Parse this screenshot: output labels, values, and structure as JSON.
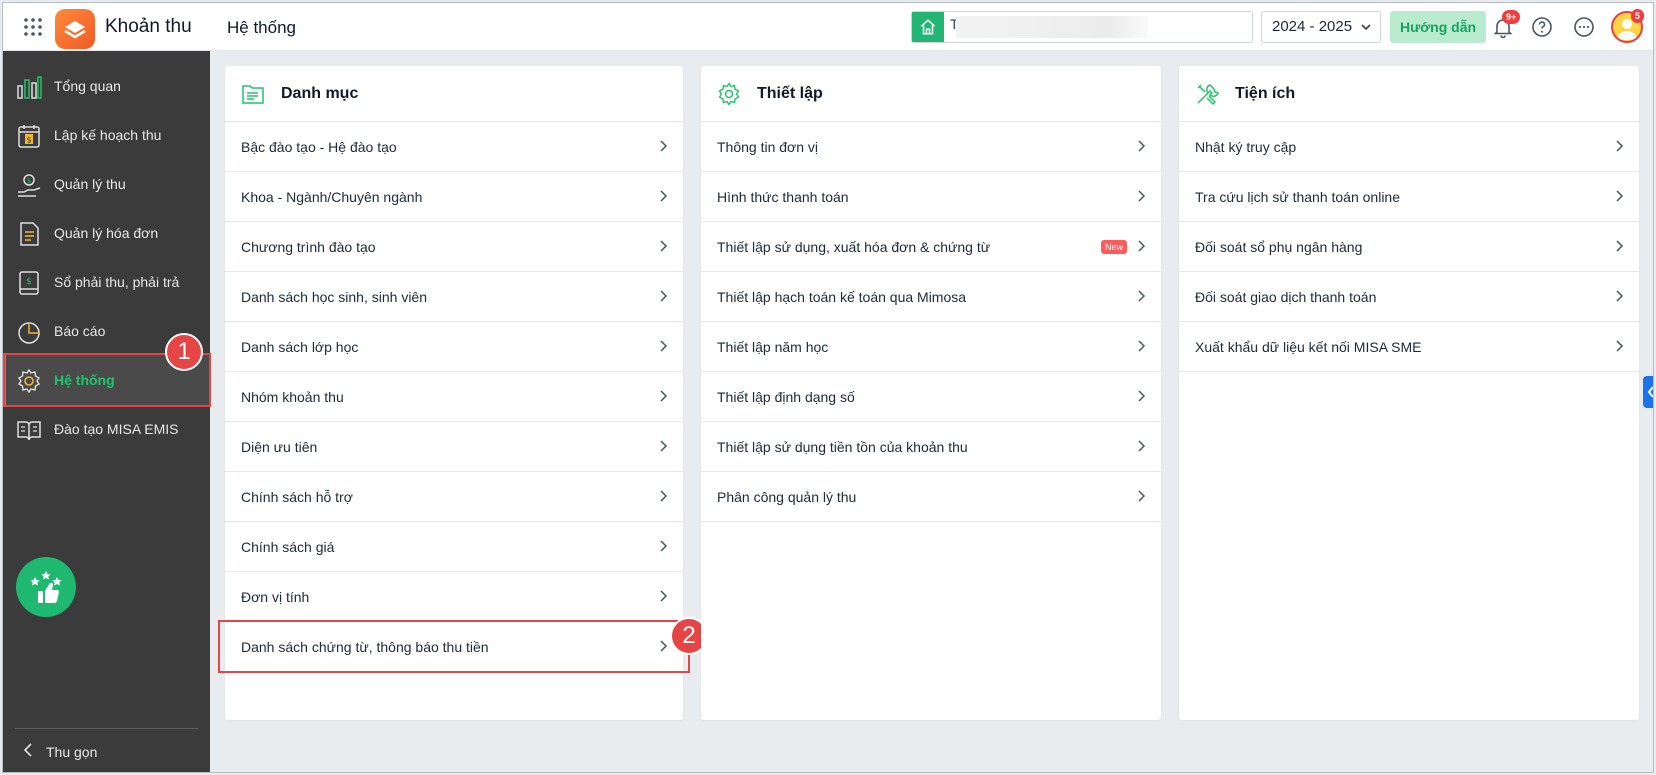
{
  "header": {
    "app_title": "Khoản thu",
    "page_title": "Hệ thống",
    "search_value": "T",
    "school_year": "2024 - 2025",
    "guide_label": "Hướng dẫn",
    "notification_badge": "9+",
    "avatar_badge": "5"
  },
  "sidebar": {
    "items": [
      {
        "label": "Tổng quan",
        "icon": "bar-chart-icon"
      },
      {
        "label": "Lập kế hoạch thu",
        "icon": "calendar-dollar-icon"
      },
      {
        "label": "Quản lý thu",
        "icon": "hand-coin-icon"
      },
      {
        "label": "Quản lý hóa đơn",
        "icon": "invoice-icon"
      },
      {
        "label": "Sổ phải thu, phải trả",
        "icon": "ledger-icon"
      },
      {
        "label": "Báo cáo",
        "icon": "pie-chart-icon"
      },
      {
        "label": "Hệ thống",
        "icon": "gear-icon",
        "active": true
      },
      {
        "label": "Đào tạo MISA EMIS",
        "icon": "book-icon"
      }
    ],
    "collapse_label": "Thu gọn"
  },
  "annotations": {
    "step1": "1",
    "step2": "2"
  },
  "panels": [
    {
      "title": "Danh mục",
      "icon": "folder-list-icon",
      "items": [
        "Bậc đào tạo - Hệ đào tạo",
        "Khoa - Ngành/Chuyên ngành",
        "Chương trình đào tạo",
        "Danh sách học sinh, sinh viên",
        "Danh sách lớp học",
        "Nhóm khoản thu",
        "Diện ưu tiên",
        "Chính sách hỗ trợ",
        "Chính sách giá",
        "Đơn vị tính",
        "Danh sách chứng từ, thông báo thu tiền"
      ]
    },
    {
      "title": "Thiết lập",
      "icon": "settings-icon",
      "items": [
        "Thông tin đơn vị",
        "Hình thức thanh toán",
        "Thiết lập sử dụng, xuất hóa đơn & chứng từ",
        "Thiết lập hạch toán kế toán qua Mimosa",
        "Thiết lập năm học",
        "Thiết lập định dạng số",
        "Thiết lập sử dụng tiền tồn của khoản thu",
        "Phân công quản lý thu"
      ],
      "new_tag": "New"
    },
    {
      "title": "Tiện ích",
      "icon": "tools-icon",
      "items": [
        "Nhật ký truy cập",
        "Tra cứu lịch sử thanh toán online",
        "Đối soát sổ phụ ngân hàng",
        "Đối soát giao dịch thanh toán",
        "Xuất khẩu dữ liệu kết nối MISA SME"
      ]
    }
  ],
  "colors": {
    "accent": "#22c26b",
    "sidebar_bg": "#3b3b3b",
    "annotation": "#e64545"
  }
}
